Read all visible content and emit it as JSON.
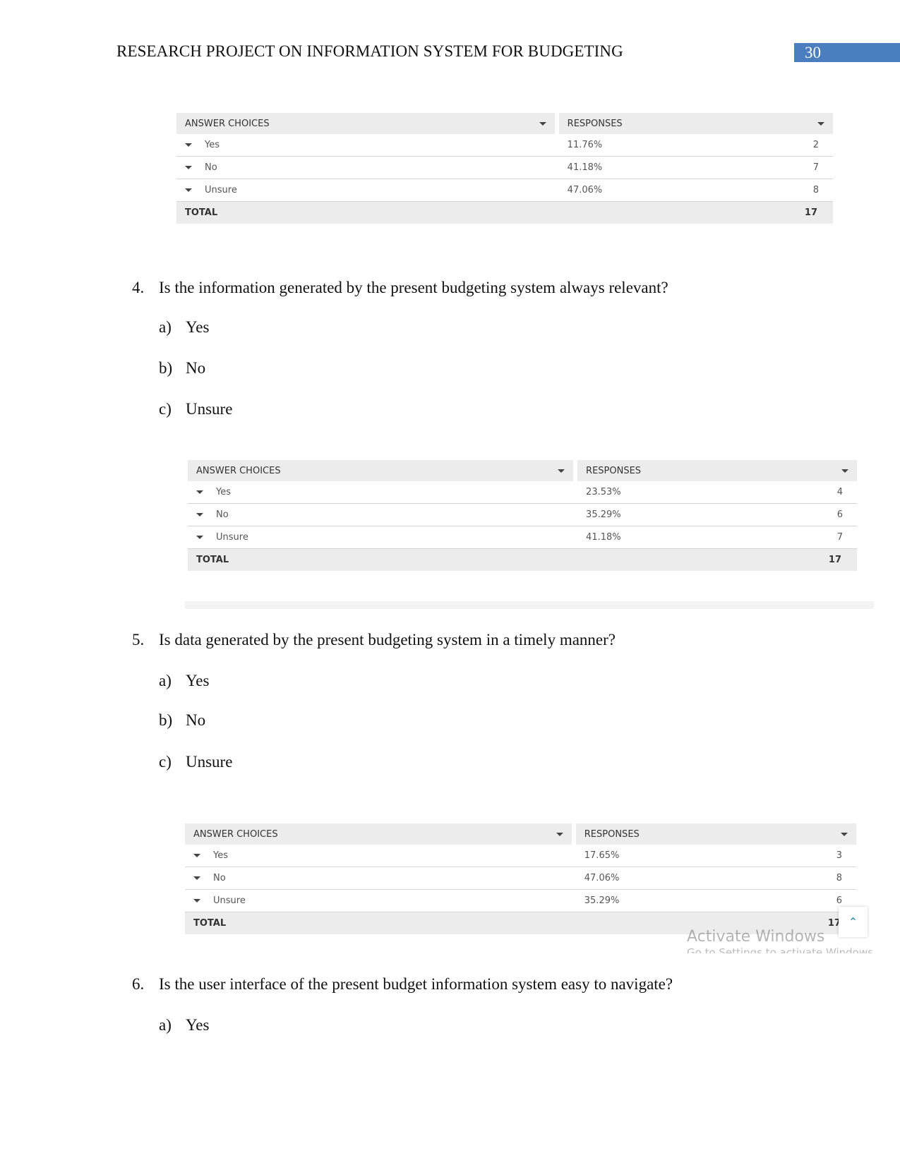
{
  "header": {
    "title": "RESEARCH PROJECT ON INFORMATION SYSTEM FOR BUDGETING",
    "page_number": "30",
    "accent_color": "#4a7ebf"
  },
  "table_labels": {
    "answer_choices": "ANSWER CHOICES",
    "responses": "RESPONSES",
    "total": "TOTAL"
  },
  "tables": [
    {
      "rows": [
        {
          "choice": "Yes",
          "percent": "11.76%",
          "count": "2"
        },
        {
          "choice": "No",
          "percent": "41.18%",
          "count": "7"
        },
        {
          "choice": "Unsure",
          "percent": "47.06%",
          "count": "8"
        }
      ],
      "total": "17"
    },
    {
      "rows": [
        {
          "choice": "Yes",
          "percent": "23.53%",
          "count": "4"
        },
        {
          "choice": "No",
          "percent": "35.29%",
          "count": "6"
        },
        {
          "choice": "Unsure",
          "percent": "41.18%",
          "count": "7"
        }
      ],
      "total": "17"
    },
    {
      "rows": [
        {
          "choice": "Yes",
          "percent": "17.65%",
          "count": "3"
        },
        {
          "choice": "No",
          "percent": "47.06%",
          "count": "8"
        },
        {
          "choice": "Unsure",
          "percent": "35.29%",
          "count": "6"
        }
      ],
      "total": "17"
    }
  ],
  "questions": [
    {
      "num": "4.",
      "text": "Is the information generated by the present budgeting system always relevant?",
      "options": [
        {
          "letter": "a)",
          "text": "Yes"
        },
        {
          "letter": "b)",
          "text": "No"
        },
        {
          "letter": "c)",
          "text": "Unsure"
        }
      ]
    },
    {
      "num": "5.",
      "text": "Is data generated by the present budgeting system in a timely manner?",
      "options": [
        {
          "letter": "a)",
          "text": "Yes"
        },
        {
          "letter": "b)",
          "text": "No"
        },
        {
          "letter": "c)",
          "text": "Unsure"
        }
      ]
    },
    {
      "num": "6.",
      "text": "Is the user interface of the present budget information system easy to navigate?",
      "options": [
        {
          "letter": "a)",
          "text": "Yes"
        }
      ]
    }
  ],
  "watermark": {
    "title": "Activate Windows",
    "subtitle": "Go to Settings to activate Windows."
  },
  "icons": {
    "scroll_up": "chevron-up-icon",
    "row_toggle": "caret-down-icon"
  }
}
